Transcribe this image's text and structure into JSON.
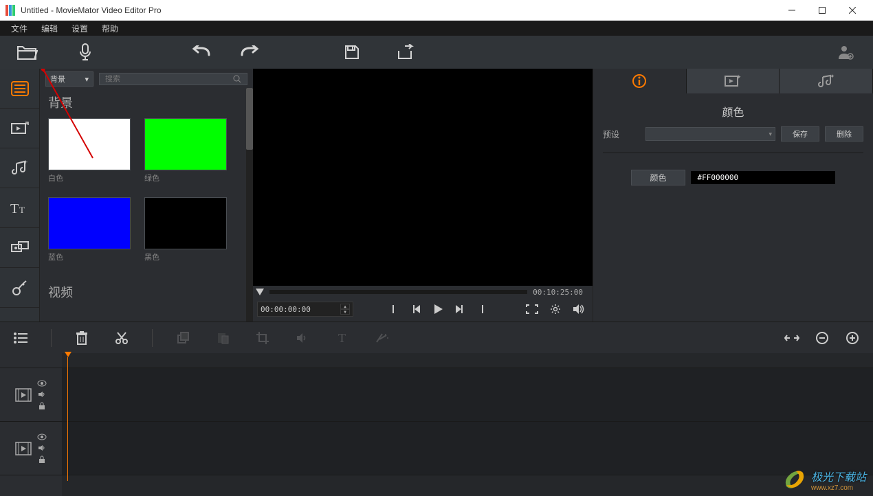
{
  "window": {
    "title": "Untitled - MovieMator Video Editor Pro"
  },
  "menu": {
    "items": [
      "文件",
      "编辑",
      "设置",
      "帮助"
    ]
  },
  "media": {
    "category_combo": "背景",
    "search_placeholder": "搜索",
    "section1_title": "背景",
    "section2_title": "视频",
    "thumbs": [
      {
        "label": "白色",
        "color": "#ffffff"
      },
      {
        "label": "绿色",
        "color": "#00ff00"
      },
      {
        "label": "蓝色",
        "color": "#0000ff"
      },
      {
        "label": "黑色",
        "color": "#000000"
      }
    ]
  },
  "preview": {
    "end_time": "00:10:25:00",
    "current_time": "00:00:00:00"
  },
  "props": {
    "title": "颜色",
    "preset_label": "预设",
    "save_label": "保存",
    "delete_label": "删除",
    "color_btn": "颜色",
    "hex": "#FF000000"
  },
  "watermark": {
    "main": "极光下载站",
    "sub": "www.xz7.com"
  }
}
